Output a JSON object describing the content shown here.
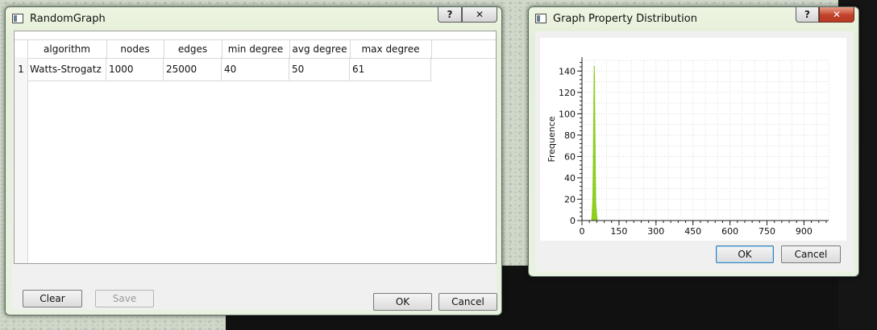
{
  "window1": {
    "title": "RandomGraph",
    "help": "?",
    "close": "✕",
    "table": {
      "headers": [
        "algorithm",
        "nodes",
        "edges",
        "min degree",
        "avg degree",
        "max degree"
      ],
      "rows": [
        {
          "num": "1",
          "cells": [
            "Watts-Strogatz",
            "1000",
            "25000",
            "40",
            "50",
            "61"
          ]
        }
      ]
    },
    "buttons": {
      "clear": "Clear",
      "save": "Save",
      "ok": "OK",
      "cancel": "Cancel"
    }
  },
  "window2": {
    "title": "Graph Property Distribution",
    "help": "?",
    "close": "✕",
    "buttons": {
      "ok": "OK",
      "cancel": "Cancel"
    }
  },
  "chart_data": {
    "type": "area",
    "ylabel": "Frequence",
    "xlabel": "",
    "xlim": [
      0,
      1000
    ],
    "ylim": [
      0,
      150
    ],
    "xticks": [
      0,
      150,
      300,
      450,
      600,
      750,
      900
    ],
    "yticks": [
      0,
      20,
      40,
      60,
      80,
      100,
      120,
      140
    ],
    "grid": true,
    "color": "#8ccf1f",
    "series": [
      {
        "x": [
          40,
          44,
          46,
          48,
          49,
          50,
          51,
          52,
          54,
          56,
          61
        ],
        "y": [
          2,
          20,
          60,
          110,
          135,
          144,
          130,
          100,
          55,
          15,
          2
        ]
      }
    ]
  }
}
